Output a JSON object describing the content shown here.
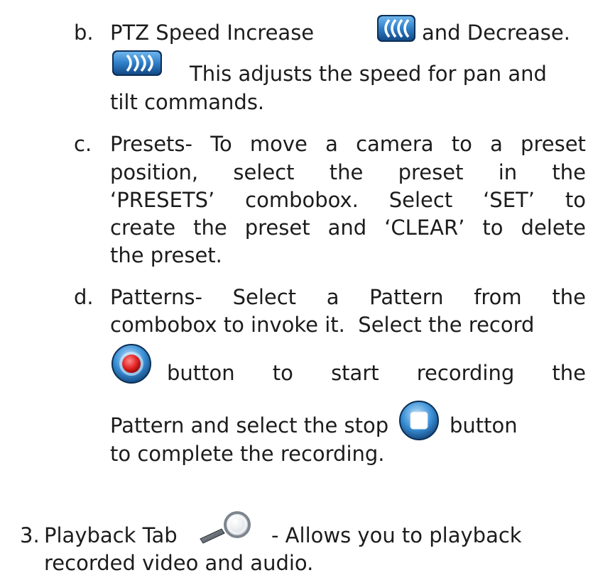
{
  "items": {
    "b": {
      "marker": "b.",
      "line1_a": "PTZ Speed Increase",
      "line1_b": "and Decrease.",
      "line2": "This adjusts the speed for pan and",
      "line3": "tilt commands.",
      "increase_icon": "speed-increase-icon",
      "decrease_icon": "speed-decrease-icon"
    },
    "c": {
      "marker": "c.",
      "lines": [
        [
          "Presets-",
          "To",
          "move",
          "a",
          "camera",
          "to",
          "a",
          "preset"
        ],
        [
          "position,",
          "select",
          "the",
          "preset",
          "in",
          "the"
        ],
        [
          "‘PRESETS’",
          "combobox.",
          "Select",
          "‘SET’",
          "to"
        ],
        [
          "create",
          "the",
          "preset",
          "and",
          "‘CLEAR’",
          "to",
          "delete"
        ],
        [
          "the preset."
        ]
      ]
    },
    "d": {
      "marker": "d.",
      "lines": [
        [
          "Patterns-",
          "Select",
          "a",
          "Pattern",
          "from",
          "the"
        ],
        [
          "combobox to invoke it.  Select the record"
        ],
        [
          "button",
          "to",
          "start",
          "recording",
          "the"
        ],
        [
          "Pattern and select the stop"
        ],
        [
          "button"
        ],
        [
          "to complete the recording."
        ]
      ],
      "record_icon": "record-button-icon",
      "stop_icon": "stop-button-icon"
    }
  },
  "section3": {
    "marker": "3.",
    "line1_a": "Playback Tab",
    "line1_b": "- Allows you to playback",
    "line2": "recorded video and audio.",
    "icon": "magnifier-icon"
  },
  "colors": {
    "text": "#1c1c1c",
    "icon_blue": "#2f7fc8",
    "record_red": "#e02020"
  }
}
